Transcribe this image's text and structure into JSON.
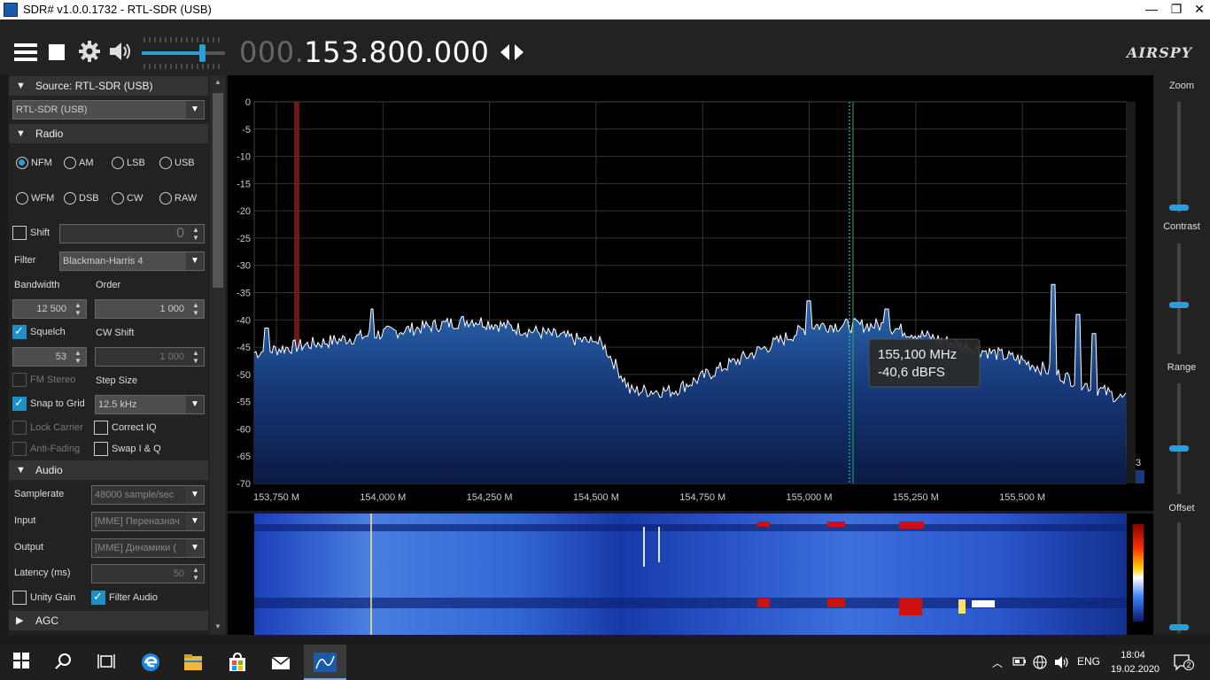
{
  "window": {
    "title": "SDR# v1.0.0.1732 - RTL-SDR (USB)",
    "minimize": "—",
    "maximize": "❐",
    "close": "✕"
  },
  "toolbar": {
    "freq_dim": "000.",
    "freq_main": "153.800.000",
    "brand": "AIRSPY",
    "volume_fraction": 0.72
  },
  "source": {
    "header": "Source: RTL-SDR (USB)",
    "device": "RTL-SDR (USB)"
  },
  "radio": {
    "header": "Radio",
    "modes": [
      "NFM",
      "AM",
      "LSB",
      "USB",
      "WFM",
      "DSB",
      "CW",
      "RAW"
    ],
    "selected_mode": "NFM",
    "shift_label": "Shift",
    "shift_value": "0",
    "filter_label": "Filter",
    "filter_value": "Blackman-Harris 4",
    "bandwidth_label": "Bandwidth",
    "bandwidth_value": "12 500",
    "order_label": "Order",
    "order_value": "1 000",
    "squelch_label": "Squelch",
    "squelch_value": "53",
    "cwshift_label": "CW Shift",
    "cwshift_value": "1 000",
    "fmstereo_label": "FM Stereo",
    "stepsize_label": "Step Size",
    "snap_label": "Snap to Grid",
    "step_value": "12.5 kHz",
    "lockcarrier_label": "Lock Carrier",
    "correctiq_label": "Correct IQ",
    "antifading_label": "Anti-Fading",
    "swapiq_label": "Swap I & Q"
  },
  "audio": {
    "header": "Audio",
    "samplerate_label": "Samplerate",
    "samplerate_value": "48000 sample/sec",
    "input_label": "Input",
    "input_value": "[MME] Переназнач",
    "output_label": "Output",
    "output_value": "[MME] Динамики (",
    "latency_label": "Latency (ms)",
    "latency_value": "50",
    "unitygain_label": "Unity Gain",
    "filteraudio_label": "Filter Audio"
  },
  "agc": {
    "header": "AGC"
  },
  "spectrum": {
    "y_ticks": [
      "0",
      "-5",
      "-10",
      "-15",
      "-20",
      "-25",
      "-30",
      "-35",
      "-40",
      "-45",
      "-50",
      "-55",
      "-60",
      "-65",
      "-70"
    ],
    "x_ticks": [
      "153,750 M",
      "154,000 M",
      "154,250 M",
      "154,500 M",
      "154,750 M",
      "155,000 M",
      "155,250 M",
      "155,500 M"
    ],
    "tooltip_freq": "155,100 MHz",
    "tooltip_level": "-40,6 dBFS",
    "corner_value": "3"
  },
  "right": {
    "zoom": "Zoom",
    "contrast": "Contrast",
    "range": "Range",
    "offset": "Offset"
  },
  "taskbar": {
    "lang": "ENG",
    "time": "18:04",
    "date": "19.02.2020",
    "notifications": "2"
  }
}
